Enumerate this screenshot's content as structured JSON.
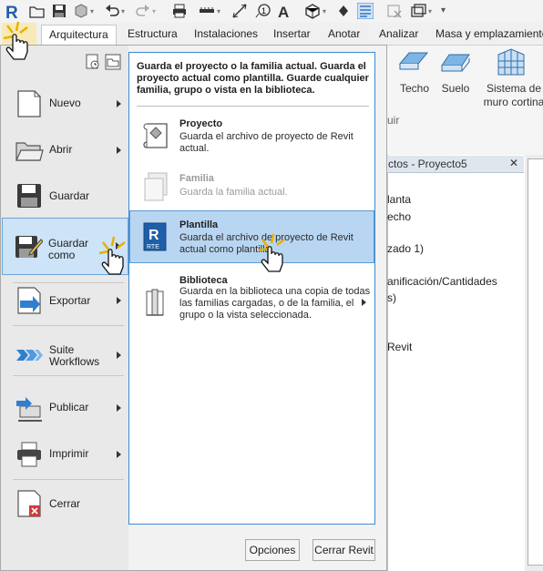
{
  "quick_access": {
    "icons": [
      "revit-logo-icon",
      "open-icon",
      "save-icon",
      "sync-icon",
      "undo-icon",
      "redo-icon",
      "print-icon",
      "measure-icon",
      "dimension-icon",
      "tag-icon",
      "text-icon",
      "3d-view-icon",
      "section-icon",
      "thin-lines-icon",
      "close-hidden-icon",
      "switch-windows-icon",
      "dropdown-icon"
    ]
  },
  "ribbon": {
    "tabs": [
      "Arquitectura",
      "Estructura",
      "Instalaciones",
      "Insertar",
      "Anotar",
      "Analizar",
      "Masa y emplazamiento"
    ],
    "tools": [
      "Techo",
      "Suelo",
      "Sistema de",
      "muro cortina"
    ],
    "panel_fragment": "uir"
  },
  "browser": {
    "title": "ctos - Proyecto5",
    "close": "✕",
    "lines": [
      "lanta",
      "echo",
      "zado 1)",
      "anificación/Cantidades",
      "s)",
      "Revit"
    ]
  },
  "menu": {
    "left_items": [
      {
        "label": "Nuevo",
        "arrow": true
      },
      {
        "label": "Abrir",
        "arrow": true
      },
      {
        "label": "Guardar",
        "arrow": false
      },
      {
        "label": "Guardar\ncomo",
        "arrow": true
      },
      {
        "label": "Exportar",
        "arrow": true
      },
      {
        "label": "Suite\nWorkflows",
        "arrow": true
      },
      {
        "label": "Publicar",
        "arrow": true
      },
      {
        "label": "Imprimir",
        "arrow": true
      },
      {
        "label": "Cerrar",
        "arrow": false
      }
    ],
    "header_text": "Guarda el proyecto o la familia actual. Guarda el proyecto actual como plantilla. Guarde cualquier familia, grupo o vista en la biblioteca.",
    "right_items": [
      {
        "title": "Proyecto",
        "desc": "Guarda el archivo de proyecto de Revit actual.",
        "disabled": false
      },
      {
        "title": "Familia",
        "desc": "Guarda la familia actual.",
        "disabled": true
      },
      {
        "title": "Plantilla",
        "desc": "Guarda el archivo de proyecto de Revit actual como plantilla.",
        "disabled": false
      },
      {
        "title": "Biblioteca",
        "desc": "Guarda en la biblioteca una copia de todas las familias cargadas, o de la familia, el grupo o la vista seleccionada.",
        "disabled": false
      }
    ],
    "buttons": {
      "options": "Opciones",
      "close": "Cerrar Revit"
    }
  },
  "colors": {
    "accent": "#3d8ad1",
    "selection": "#b8d6f2",
    "revit_blue": "#1f5ea8"
  }
}
